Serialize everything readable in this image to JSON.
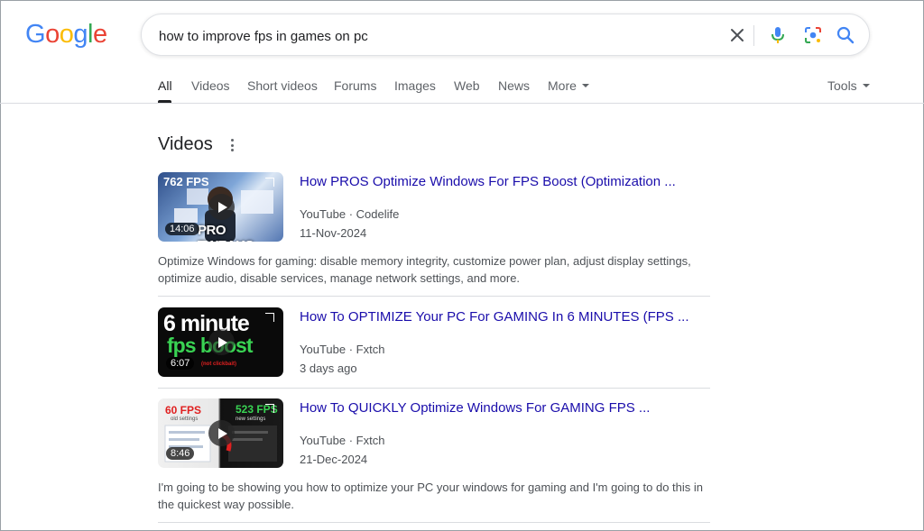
{
  "logo": {
    "letters": [
      "G",
      "o",
      "o",
      "g",
      "l",
      "e"
    ],
    "colors": [
      "#4285f4",
      "#ea4335",
      "#fbbc05",
      "#4285f4",
      "#34a853",
      "#ea4335"
    ]
  },
  "search": {
    "query": "how to improve fps in games on pc",
    "icons": [
      "close-icon",
      "mic-icon",
      "lens-icon",
      "search-icon"
    ]
  },
  "tabs": [
    {
      "label": "All",
      "active": true
    },
    {
      "label": "Videos"
    },
    {
      "label": "Short videos"
    },
    {
      "label": "Forums"
    },
    {
      "label": "Images"
    },
    {
      "label": "Web"
    },
    {
      "label": "News"
    },
    {
      "label": "More"
    }
  ],
  "tools_label": "Tools",
  "videos_section": {
    "title": "Videos",
    "items": [
      {
        "title": "How PROS Optimize Windows For FPS Boost (Optimization ...",
        "source": "YouTube · Codelife",
        "date": "11-Nov-2024",
        "duration": "14:06",
        "thumb_text_top": "762 FPS",
        "thumb_text_bottom": "PRO TWEAKS",
        "description": "Optimize Windows for gaming: disable memory integrity, customize power plan, adjust display settings, optimize audio, disable services, manage network settings, and more."
      },
      {
        "title": "How To OPTIMIZE Your PC For GAMING In 6 MINUTES (FPS ...",
        "source": "YouTube · Fxtch",
        "date": "3 days ago",
        "duration": "6:07",
        "thumb_text_top": "6 minute",
        "thumb_text_bottom": "fps boost",
        "thumb_text_small": "(not clickbait)"
      },
      {
        "title": "How To QUICKLY Optimize Windows For GAMING FPS ...",
        "source": "YouTube · Fxtch",
        "date": "21-Dec-2024",
        "duration": "8:46",
        "thumb_text_top": "60 FPS",
        "thumb_text_right": "523 FPS",
        "thumb_text_small_left": "old settings",
        "thumb_text_small_right": "new settings",
        "description": "I'm going to be showing you how to optimize your PC your windows for gaming and I'm going to do this in the quickest way possible."
      }
    ]
  }
}
